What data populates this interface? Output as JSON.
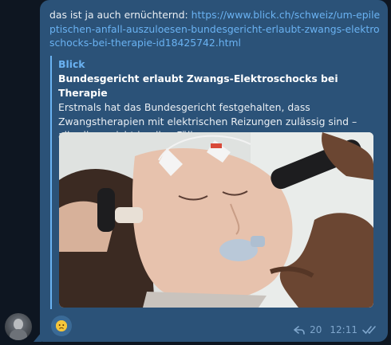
{
  "message": {
    "text_prefix": "das ist ja auch ernüchternd: ",
    "link_text": "https://www.blick.ch/schweiz/um-epileptischen-anfall-auszuloesen-bundesgericht-erlaubt-zwangs-elektroschocks-bei-therapie-id18425742.html",
    "preview": {
      "site_name": "Blick",
      "title": "Bundesgericht erlaubt Zwangs-Elektroschocks bei Therapie",
      "description": "Erstmals hat das Bundesgericht festgehalten, dass Zwangstherapien mit elektrischen Reizungen zulässig sind – allerdings nicht in allen Fällen."
    },
    "reaction_emoji": "worried-face",
    "replies_count": "20",
    "time": "12:11",
    "status": "read-double-check"
  },
  "colors": {
    "bubble": "#2b5278",
    "link": "#6ab2f2",
    "meta": "#7fa6cc",
    "background": "#0e1621"
  }
}
